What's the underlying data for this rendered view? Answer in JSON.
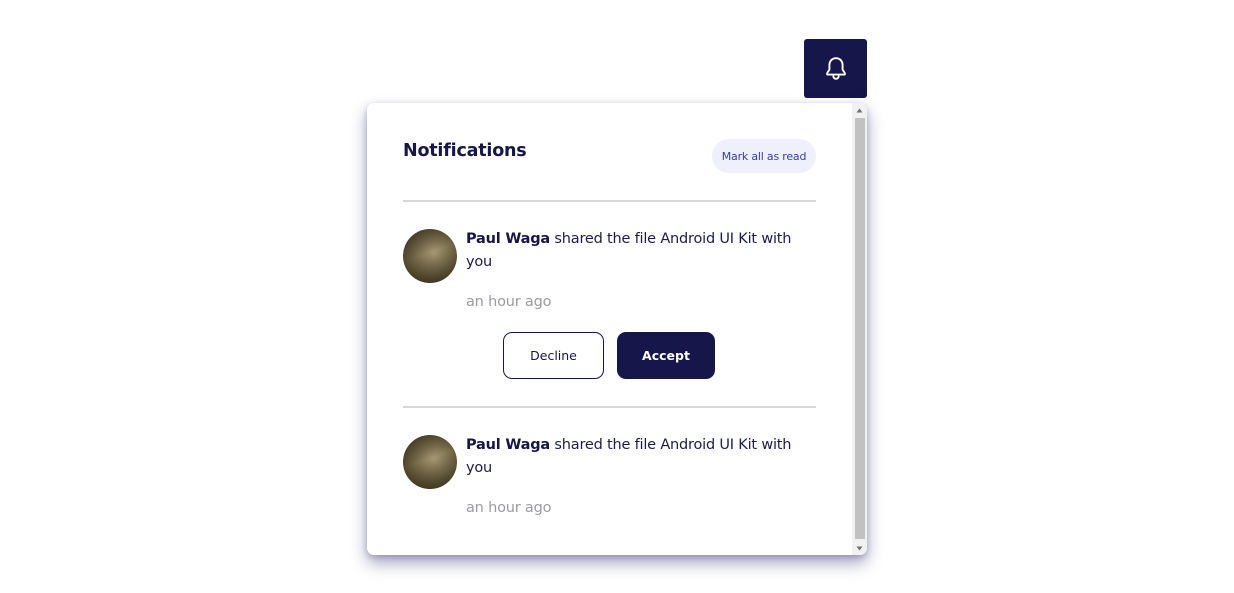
{
  "bell": {
    "icon": "bell-icon",
    "background": "#17164a"
  },
  "panel": {
    "title": "Notifications",
    "mark_all_read_label": "Mark all as read"
  },
  "notifications": [
    {
      "actor": "Paul Waga",
      "message": " shared the file Android UI Kit with you",
      "time": "an hour ago",
      "avatar": "avatar-photo",
      "actions": {
        "decline": "Decline",
        "accept": "Accept"
      }
    },
    {
      "actor": "Paul Waga",
      "message": " shared the file Android UI Kit with you",
      "time": "an hour ago",
      "avatar": "avatar-photo"
    }
  ],
  "colors": {
    "primary": "#17164a",
    "chip_bg": "#eef0fb",
    "chip_text": "#3a3f9e",
    "muted": "#9b9ba3"
  }
}
